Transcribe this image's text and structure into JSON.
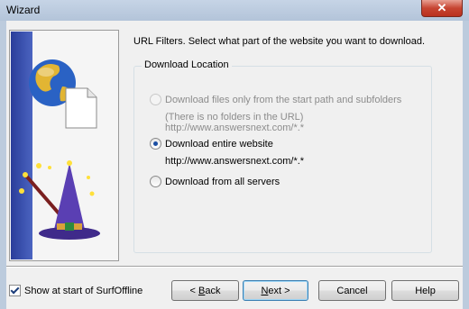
{
  "window": {
    "title": "Wizard",
    "close_glyph": "✕"
  },
  "header": {
    "text": "URL Filters. Select what part of the website you want to download."
  },
  "download_location": {
    "legend": "Download Location",
    "options": [
      {
        "label": "Download files only from the start path and subfolders",
        "detail": "(There is no folders in the URL) http://www.answersnext.com/*.*",
        "checked": false,
        "enabled": false
      },
      {
        "label": "Download entire website",
        "detail": "http://www.answersnext.com/*.*",
        "checked": true,
        "enabled": true
      },
      {
        "label": "Download from all servers",
        "checked": false,
        "enabled": true
      }
    ]
  },
  "footer": {
    "show_at_start_label": "Show at start of SurfOffline",
    "show_at_start_checked": true,
    "back_label": {
      "prefix": "< ",
      "mnemonic": "B",
      "rest": "ack"
    },
    "next_label": {
      "mnemonic": "N",
      "rest": "ext >"
    },
    "cancel_label": "Cancel",
    "help_label": "Help"
  },
  "colors": {
    "accent": "#1b4ea3",
    "close": "#c74532"
  },
  "icons": [
    "globe-icon",
    "document-icon",
    "wizard-hat-icon",
    "magic-wand-icon"
  ]
}
